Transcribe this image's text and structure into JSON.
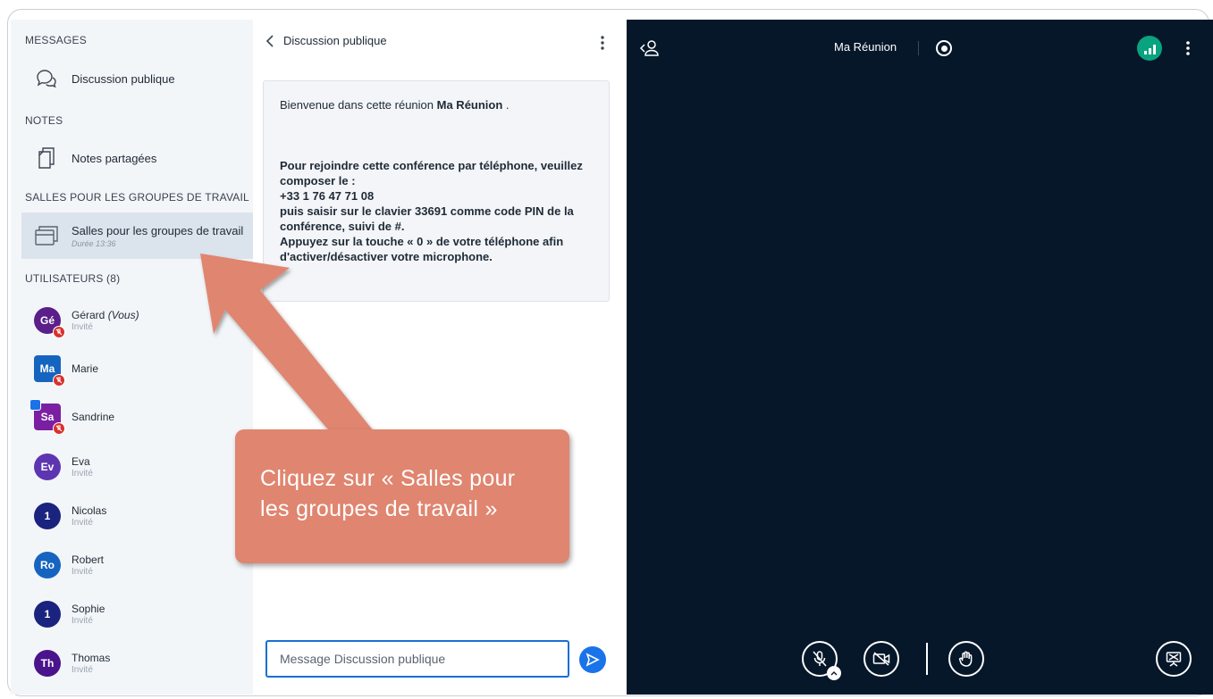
{
  "sidebar": {
    "messages_title": "MESSAGES",
    "public_chat_label": "Discussion publique",
    "notes_title": "NOTES",
    "shared_notes_label": "Notes partagées",
    "breakout_title": "SALLES POUR LES GROUPES DE TRAVAIL",
    "breakout_label": "Salles pour les groupes de travail",
    "breakout_duration": "Durée 13:36",
    "users_title": "UTILISATEURS (8)",
    "users": [
      {
        "initials": "Gé",
        "name": "Gérard",
        "you": "(Vous)",
        "role": "Invité",
        "color": "#5a1f8a"
      },
      {
        "initials": "Ma",
        "name": "Marie",
        "role": "",
        "color": "#1565c0"
      },
      {
        "initials": "Sa",
        "name": "Sandrine",
        "role": "",
        "color": "#7b1fa2"
      },
      {
        "initials": "Ev",
        "name": "Eva",
        "role": "Invité",
        "color": "#5e35b1"
      },
      {
        "initials": "1",
        "name": "Nicolas",
        "role": "Invité",
        "color": "#1a237e"
      },
      {
        "initials": "Ro",
        "name": "Robert",
        "role": "Invité",
        "color": "#1565c0"
      },
      {
        "initials": "1",
        "name": "Sophie",
        "role": "Invité",
        "color": "#1a237e"
      },
      {
        "initials": "Th",
        "name": "Thomas",
        "role": "Invité",
        "color": "#4a148c"
      }
    ]
  },
  "chat": {
    "header": "Discussion publique",
    "welcome_prefix": "Bienvenue dans cette réunion ",
    "welcome_meeting": "Ma Réunion",
    "welcome_suffix": " .",
    "phone_line1": "Pour rejoindre cette conférence par téléphone, veuillez composer le :",
    "phone_number": "+33 1 76 47 71 08",
    "phone_line2": "puis saisir sur le clavier 33691 comme code PIN de la conférence, suivi de #.",
    "phone_line3": "Appuyez sur la touche « 0 » de votre téléphone afin d'activer/désactiver votre microphone.",
    "input_placeholder": "Message Discussion publique"
  },
  "meeting": {
    "title": "Ma Réunion"
  },
  "callout": {
    "text": "Cliquez sur « Salles pour les groupes de travail »"
  },
  "colors": {
    "accent": "#1a73e8",
    "meeting_bg": "#06172a",
    "callout": "#e0856f",
    "connection_ok": "#0aa37f"
  }
}
